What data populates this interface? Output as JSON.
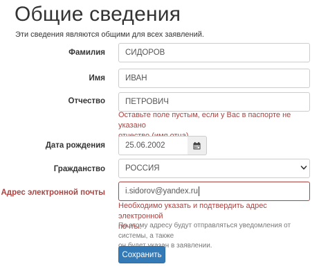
{
  "form": {
    "title": "Общие сведения",
    "subtitle": "Эти сведения являются общими для всех заявлений.",
    "fields": {
      "last_name": {
        "label": "Фамилия",
        "value": "СИДОРОВ"
      },
      "first_name": {
        "label": "Имя",
        "value": "ИВАН"
      },
      "patronymic": {
        "label": "Отчество",
        "value": "ПЕТРОВИЧ",
        "error_line1": "Оставьте поле пустым, если у Вас в паспорте не указано",
        "error_line2": "отчество (имя отца)."
      },
      "birth_date": {
        "label": "Дата рождения",
        "value": "25.06.2002",
        "icon": "calendar-icon"
      },
      "citizenship": {
        "label": "Гражданство",
        "value": "РОССИЯ",
        "icon": "chevron-down-icon"
      },
      "email": {
        "label": "Адрес электронной почты",
        "value": "i.sidorov@yandex.ru",
        "error_line1": "Необходимо указать и подтвердить адрес электронной",
        "error_line2": "почты.",
        "help_line1": "По этому адресу будут отправляться уведомления от системы, а также",
        "help_line2": "он будет указан в заявлении."
      }
    },
    "save_label": "Сохранить"
  },
  "colors": {
    "primary": "#337ab7",
    "error": "#a94442",
    "border": "#cccccc",
    "addon_bg": "#eeeeee"
  }
}
